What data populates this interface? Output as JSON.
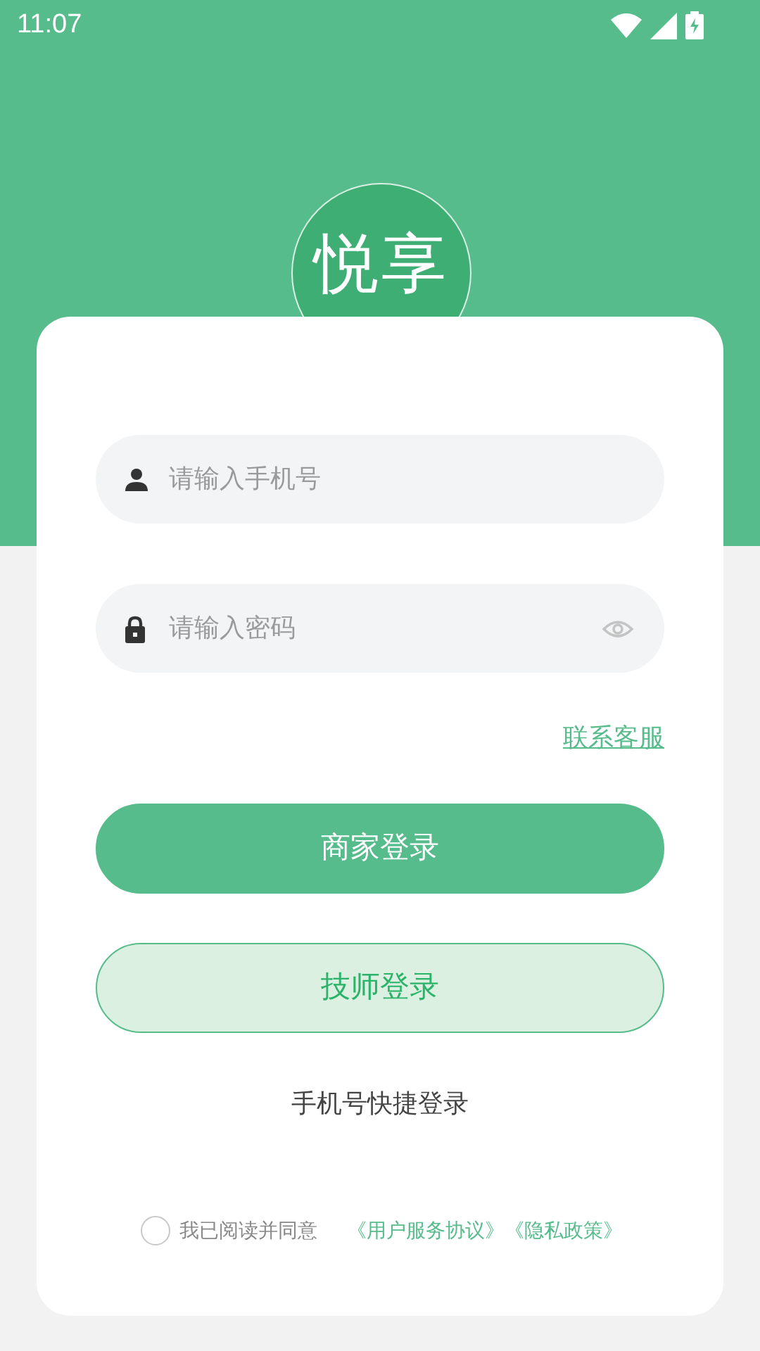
{
  "status_bar": {
    "time": "11:07"
  },
  "logo": {
    "text": "悦享"
  },
  "phone_field": {
    "placeholder": "请输入手机号"
  },
  "password_field": {
    "placeholder": "请输入密码",
    "visible": false
  },
  "contact_link": "联系客服",
  "buttons": [
    {
      "label": "商家登录",
      "kind": "primary"
    },
    {
      "label": "技师登录",
      "kind": "secondary"
    }
  ],
  "quick_login": "手机号快捷登录",
  "agreement": {
    "checked": false,
    "text": "我已阅读并同意",
    "links": [
      "《用户服务协议》",
      "《隐私政策》"
    ]
  }
}
